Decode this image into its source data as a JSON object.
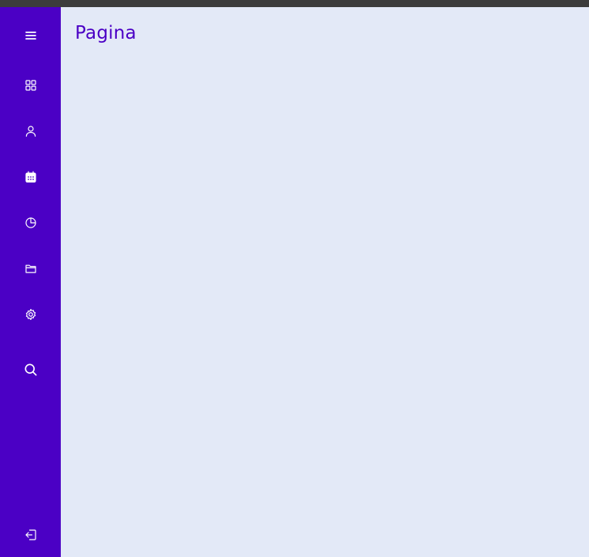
{
  "page": {
    "title": "Pagina"
  },
  "sidebar": {
    "items": [
      {
        "icon": "menu-icon"
      },
      {
        "icon": "dashboard-icon"
      },
      {
        "icon": "user-icon"
      },
      {
        "icon": "calendar-icon"
      },
      {
        "icon": "chart-pie-icon"
      },
      {
        "icon": "folder-icon"
      },
      {
        "icon": "settings-icon"
      },
      {
        "icon": "search-icon"
      },
      {
        "icon": "logout-icon"
      }
    ]
  },
  "colors": {
    "sidebar_bg": "#4b00c5",
    "main_bg": "#e3e9f7",
    "accent": "#4b00c5",
    "topbar": "#3c3c3c",
    "icon": "#ffffff"
  }
}
